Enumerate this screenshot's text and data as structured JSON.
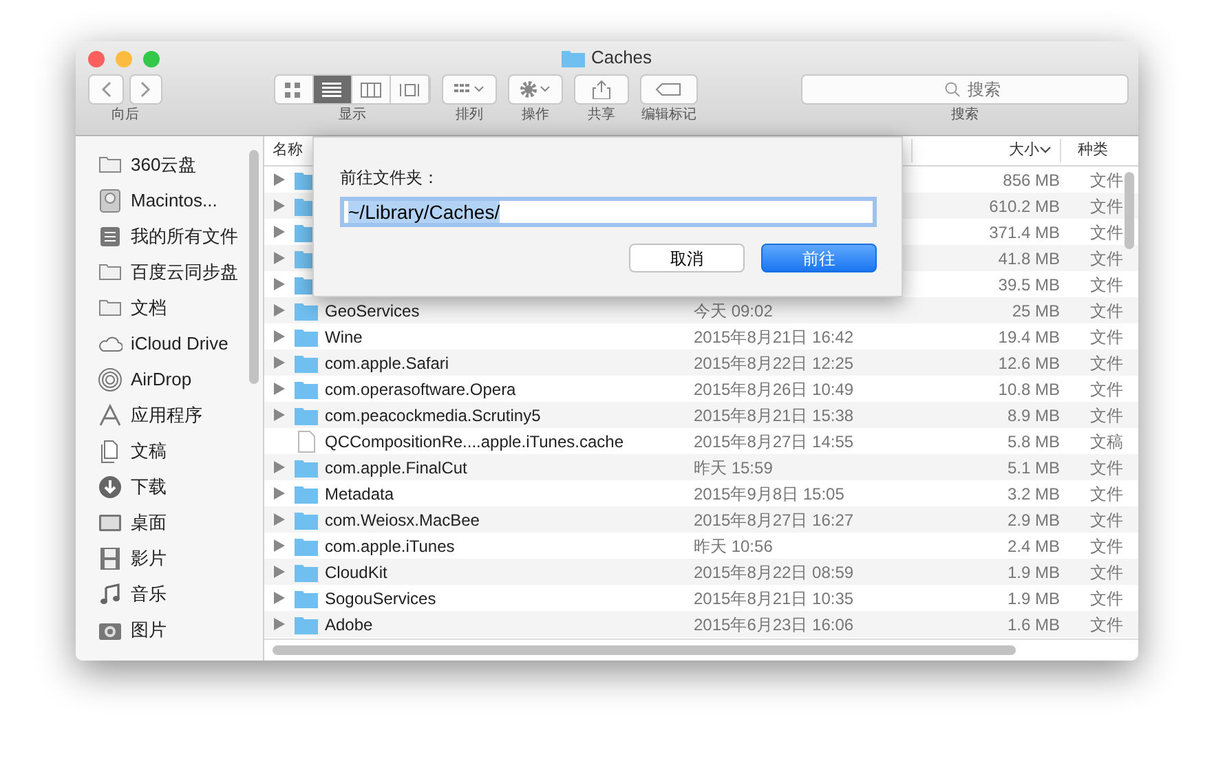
{
  "window": {
    "title": "Caches"
  },
  "toolbar": {
    "nav": {
      "label": "向后"
    },
    "view": {
      "label": "显示",
      "modes": [
        {
          "kind": "icons",
          "selected": false
        },
        {
          "kind": "list",
          "selected": true
        },
        {
          "kind": "columns",
          "selected": false
        },
        {
          "kind": "coverflow",
          "selected": false
        }
      ]
    },
    "buttons": [
      {
        "kind": "arrange",
        "label": "排列"
      },
      {
        "kind": "action",
        "label": "操作"
      },
      {
        "kind": "share",
        "label": "共享"
      },
      {
        "kind": "tags",
        "label": "编辑标记"
      }
    ],
    "search": {
      "placeholder": "搜索",
      "label": "搜索"
    }
  },
  "sidebar": {
    "items": [
      {
        "kind": "folder",
        "label": "360云盘"
      },
      {
        "kind": "disk",
        "label": "Macintos..."
      },
      {
        "kind": "allfiles",
        "label": "我的所有文件"
      },
      {
        "kind": "folder",
        "label": "百度云同步盘"
      },
      {
        "kind": "folder",
        "label": "文档"
      },
      {
        "kind": "cloud",
        "label": "iCloud Drive"
      },
      {
        "kind": "airdrop",
        "label": "AirDrop"
      },
      {
        "kind": "apps",
        "label": "应用程序"
      },
      {
        "kind": "docs",
        "label": "文稿"
      },
      {
        "kind": "download",
        "label": "下载"
      },
      {
        "kind": "desktop",
        "label": "桌面"
      },
      {
        "kind": "movies",
        "label": "影片"
      },
      {
        "kind": "music",
        "label": "音乐"
      },
      {
        "kind": "pictures",
        "label": "图片"
      }
    ]
  },
  "table": {
    "columns": [
      {
        "label": "名称"
      },
      {
        "label": "大小",
        "sorted": true
      },
      {
        "label": "种类"
      }
    ],
    "rows": [
      {
        "kind": "folder",
        "size": "856 MB",
        "type": "文件"
      },
      {
        "kind": "folder",
        "size": "610.2 MB",
        "type": "文件"
      },
      {
        "kind": "folder",
        "size": "371.4 MB",
        "type": "文件"
      },
      {
        "kind": "folder",
        "size": "41.8 MB",
        "type": "文件"
      },
      {
        "kind": "folder",
        "size": "39.5 MB",
        "type": "文件"
      },
      {
        "kind": "folder",
        "name": "GeoServices",
        "date": "今天 09:02",
        "size": "25 MB",
        "type": "文件"
      },
      {
        "kind": "folder",
        "name": "Wine",
        "date": "2015年8月21日 16:42",
        "size": "19.4 MB",
        "type": "文件"
      },
      {
        "kind": "folder",
        "name": "com.apple.Safari",
        "date": "2015年8月22日 12:25",
        "size": "12.6 MB",
        "type": "文件"
      },
      {
        "kind": "folder",
        "name": "com.operasoftware.Opera",
        "date": "2015年8月26日 10:49",
        "size": "10.8 MB",
        "type": "文件"
      },
      {
        "kind": "folder",
        "name": "com.peacockmedia.Scrutiny5",
        "date": "2015年8月21日 15:38",
        "size": "8.9 MB",
        "type": "文件"
      },
      {
        "kind": "file",
        "name": "QCCompositionRe....apple.iTunes.cache",
        "date": "2015年8月27日 14:55",
        "size": "5.8 MB",
        "type": "文稿"
      },
      {
        "kind": "folder",
        "name": "com.apple.FinalCut",
        "date": "昨天 15:59",
        "size": "5.1 MB",
        "type": "文件"
      },
      {
        "kind": "folder",
        "name": "Metadata",
        "date": "2015年9月8日 15:05",
        "size": "3.2 MB",
        "type": "文件"
      },
      {
        "kind": "folder",
        "name": "com.Weiosx.MacBee",
        "date": "2015年8月27日 16:27",
        "size": "2.9 MB",
        "type": "文件"
      },
      {
        "kind": "folder",
        "name": "com.apple.iTunes",
        "date": "昨天 10:56",
        "size": "2.4 MB",
        "type": "文件"
      },
      {
        "kind": "folder",
        "name": "CloudKit",
        "date": "2015年8月22日 08:59",
        "size": "1.9 MB",
        "type": "文件"
      },
      {
        "kind": "folder",
        "name": "SogouServices",
        "date": "2015年8月21日 10:35",
        "size": "1.9 MB",
        "type": "文件"
      },
      {
        "kind": "folder",
        "name": "Adobe",
        "date": "2015年6月23日 16:06",
        "size": "1.6 MB",
        "type": "文件"
      }
    ]
  },
  "dialog": {
    "prompt": "前往文件夹：",
    "value": "~/Library/Caches/",
    "buttons": [
      {
        "label": "取消",
        "default": false
      },
      {
        "label": "前往",
        "default": true
      }
    ]
  }
}
